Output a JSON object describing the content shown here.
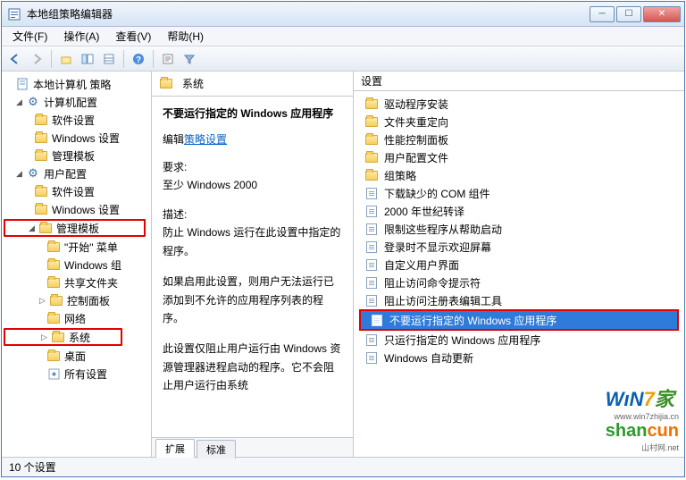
{
  "window": {
    "title": "本地组策略编辑器"
  },
  "menubar": [
    {
      "id": "file",
      "label": "文件(F)"
    },
    {
      "id": "action",
      "label": "操作(A)"
    },
    {
      "id": "view",
      "label": "查看(V)"
    },
    {
      "id": "help",
      "label": "帮助(H)"
    }
  ],
  "toolbar_icons": [
    "back",
    "forward",
    "up",
    "tree-toggle",
    "columns",
    "sep",
    "refresh",
    "sep",
    "help",
    "sep",
    "filter-props",
    "filter-funnel"
  ],
  "tree": {
    "root": {
      "label": "本地计算机 策略",
      "icon": "doc"
    },
    "computer_config": {
      "label": "计算机配置"
    },
    "cc_software": {
      "label": "软件设置"
    },
    "cc_windows": {
      "label": "Windows 设置"
    },
    "cc_admin": {
      "label": "管理模板"
    },
    "user_config": {
      "label": "用户配置"
    },
    "uc_software": {
      "label": "软件设置"
    },
    "uc_windows": {
      "label": "Windows 设置"
    },
    "uc_admin": {
      "label": "管理模板"
    },
    "start_menu": {
      "label": "\"开始\" 菜单"
    },
    "windows_comp": {
      "label": "Windows 组"
    },
    "shared_folders": {
      "label": "共享文件夹"
    },
    "control_panel": {
      "label": "控制面板"
    },
    "network": {
      "label": "网络"
    },
    "system": {
      "label": "系统"
    },
    "desktop": {
      "label": "桌面"
    },
    "all_settings": {
      "label": "所有设置"
    }
  },
  "middle": {
    "header_title": "系统",
    "policy_title": "不要运行指定的 Windows 应用程序",
    "edit_prefix": "编辑",
    "edit_link": "策略设置",
    "req_label": "要求:",
    "req_text": "至少 Windows 2000",
    "desc_label": "描述:",
    "desc_p1": "防止 Windows 运行在此设置中指定的程序。",
    "desc_p2": "如果启用此设置，则用户无法运行已添加到不允许的应用程序列表的程序。",
    "desc_p3": "此设置仅阻止用户运行由 Windows 资源管理器进程启动的程序。它不会阻止用户运行由系统"
  },
  "tabs": {
    "extended": "扩展",
    "standard": "标准"
  },
  "right": {
    "header": "设置",
    "items": [
      {
        "type": "folder",
        "label": "驱动程序安装"
      },
      {
        "type": "folder",
        "label": "文件夹重定向"
      },
      {
        "type": "folder",
        "label": "性能控制面板"
      },
      {
        "type": "folder",
        "label": "用户配置文件"
      },
      {
        "type": "folder",
        "label": "组策略"
      },
      {
        "type": "doc",
        "label": "下载缺少的 COM 组件"
      },
      {
        "type": "doc",
        "label": "2000 年世纪转译"
      },
      {
        "type": "doc",
        "label": "限制这些程序从帮助启动"
      },
      {
        "type": "doc",
        "label": "登录时不显示欢迎屏幕"
      },
      {
        "type": "doc",
        "label": "自定义用户界面"
      },
      {
        "type": "doc",
        "label": "阻止访问命令提示符"
      },
      {
        "type": "doc",
        "label": "阻止访问注册表编辑工具"
      },
      {
        "type": "doc",
        "label": "不要运行指定的 Windows 应用程序",
        "selected": true,
        "highlighted": true
      },
      {
        "type": "doc",
        "label": "只运行指定的 Windows 应用程序"
      },
      {
        "type": "doc",
        "label": "Windows 自动更新"
      }
    ]
  },
  "status": "10 个设置",
  "watermark": {
    "l1a": "WıN",
    "l1b": "7",
    "l1c": "家",
    "url": "www.win7zhijia.cn",
    "l2a": "shan",
    "l2b": "cun",
    "url2": "山村网.net"
  }
}
